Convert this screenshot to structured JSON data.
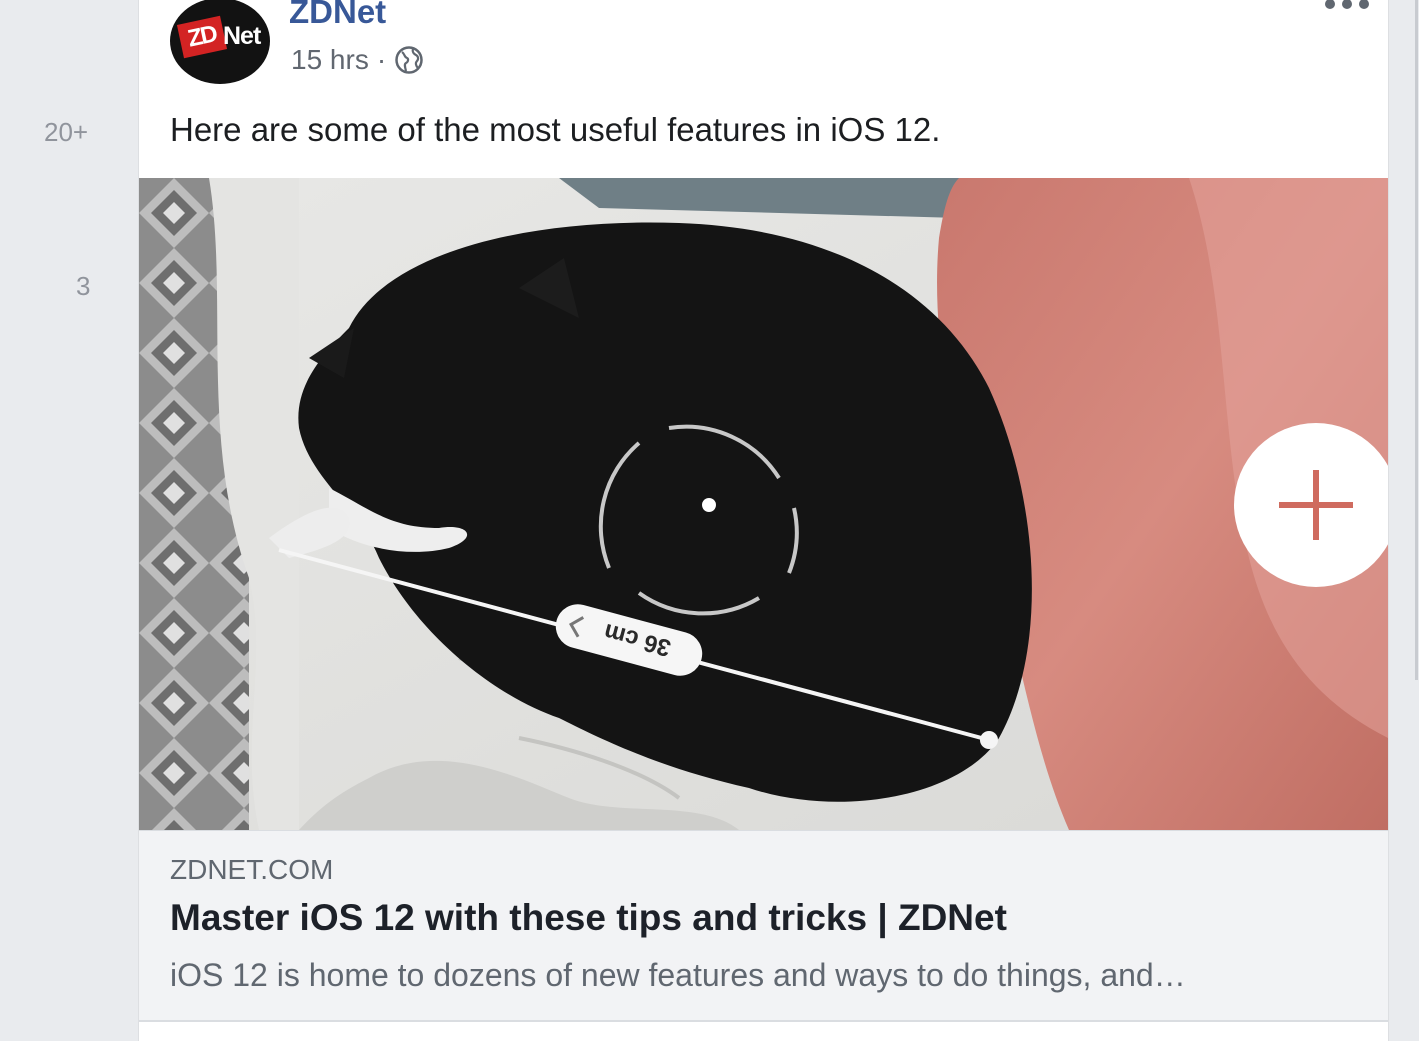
{
  "gutter": {
    "counts": [
      "20+",
      "3"
    ]
  },
  "post": {
    "author": "ZDNet",
    "avatar_logo": {
      "mark": "ZD",
      "word": "Net"
    },
    "timestamp": "15 hrs",
    "separator": "·",
    "privacy_icon": "globe-icon",
    "more_icon": "more-options-icon",
    "text": "Here are some of the most useful features in iOS 12.",
    "image": {
      "measure_label": "36 cm",
      "add_icon": "plus-icon"
    },
    "link": {
      "domain": "ZDNET.COM",
      "title": "Master iOS 12 with these tips and tricks | ZDNet",
      "description": "iOS 12 is home to dozens of new features and ways to do things, and…"
    }
  },
  "colors": {
    "page_bg": "#e9ebee",
    "author_link": "#385898",
    "logo_red": "#d32323",
    "preview_bg": "#f2f3f5"
  }
}
